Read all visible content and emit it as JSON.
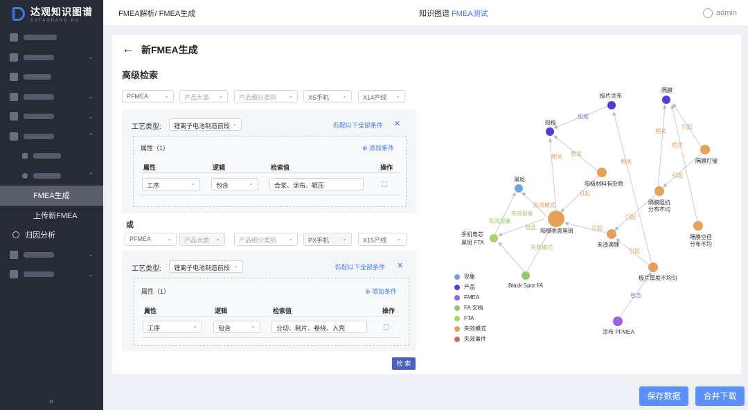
{
  "app": {
    "name": "达观知识图谱",
    "subtitle": "DATAGRAND KG"
  },
  "header": {
    "breadcrumb": "FMEA解析/ FMEA生成",
    "project_prefix": "知识图谱",
    "project_name": "FMEA测试",
    "user": "admin"
  },
  "sidebar": {
    "items": [
      {
        "label": "FMEA生成",
        "active": true
      },
      {
        "label": "上传新FMEA"
      },
      {
        "label": "归因分析"
      }
    ],
    "collapse_icon": "«"
  },
  "page": {
    "back_icon": "←",
    "title": "新FMEA生成",
    "section": "高级检索"
  },
  "filters1": {
    "type": "PFMEA",
    "category": "产品大类",
    "subcategory": "产品细分类别",
    "product": "XS手机",
    "line": "X14产线"
  },
  "filters2": {
    "type": "PFMEA",
    "category": "产品大类",
    "subcategory": "产品细分类别",
    "product": "PX手机",
    "line": "X15产线"
  },
  "block1": {
    "process_label": "工艺类型:",
    "process_value": "锂离子电池制造前段",
    "match": "匹配以下全部条件",
    "attr_title": "属性（1）",
    "add_condition": "添加条件",
    "headers": {
      "attr": "属性",
      "logic": "逻辑",
      "value": "检索值",
      "op": "操作"
    },
    "row": {
      "attr": "工序",
      "logic": "包含",
      "value": "合浆、涂布、辊压"
    }
  },
  "or_label": "或",
  "block2": {
    "process_label": "工艺类型:",
    "process_value": "锂离子电池制造前段",
    "match": "匹配以下全部条件",
    "attr_title": "属性（1）",
    "add_condition": "添加条件",
    "headers": {
      "attr": "属性",
      "logic": "逻辑",
      "value": "检索值",
      "op": "操作"
    },
    "row": {
      "attr": "工序",
      "logic": "包含",
      "value": "分切、制片、卷绕、入壳"
    }
  },
  "search_button": "检 索",
  "graph": {
    "nodes": {
      "yangji": "阳极",
      "jipian_tubu": "极片涂布",
      "gemo": "隔膜",
      "yangji_cailiao": "阳极材料有杂质",
      "gemo_dazhou": "隔膜打皱",
      "heiban": "黑斑",
      "yangji_biaomian": "阳极表面黑斑",
      "gemo_zukang": "隔膜阻抗分布不均",
      "shouji_ftasub": "手机电芯黑斑 FTA",
      "weijin_manjian": "未浸满锂",
      "gemo_kongxi": "隔膜空径分布不均",
      "black_spot": "Black Spot FA",
      "jipian_houdu": "极片厚度不均匀",
      "tubu_pfmea": "涂布 PFMEA"
    },
    "edges": {
      "zucheng": "组成",
      "xiangguan": "相关",
      "yinqi": "引起",
      "baohan": "包含",
      "shixiao_xianxiang": "失效现象",
      "shixiao_moshi": "失效模式"
    },
    "legend": [
      {
        "label": "现象",
        "color": "#6fa3e8"
      },
      {
        "label": "产品",
        "color": "#4a3fd9"
      },
      {
        "label": "FMEA",
        "color": "#9b63e0"
      },
      {
        "label": "FA 文档",
        "color": "#8ec96b"
      },
      {
        "label": "FTA",
        "color": "#a6d46a"
      },
      {
        "label": "失效模式",
        "color": "#e5a05a"
      },
      {
        "label": "失效事件",
        "color": "#c96a6a"
      }
    ]
  },
  "buttons": {
    "save": "保存数据",
    "merge": "合并下载"
  }
}
